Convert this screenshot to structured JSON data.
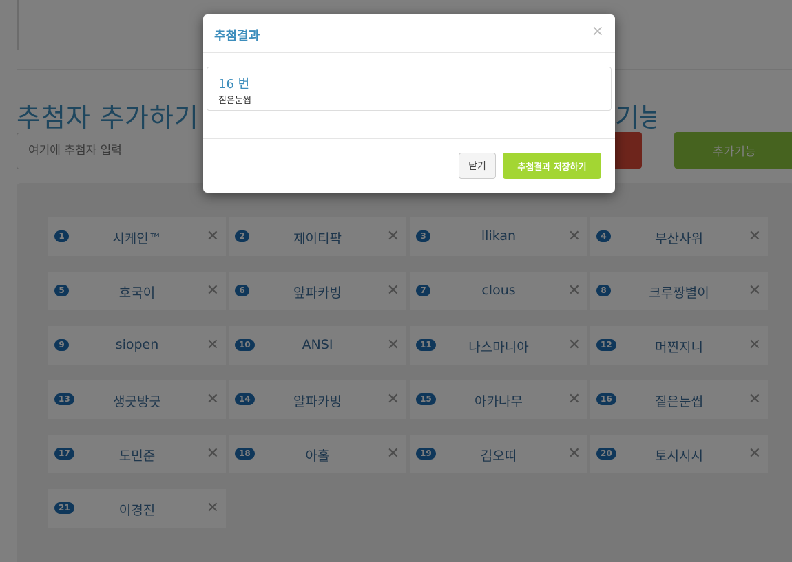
{
  "page": {
    "section_title": "추첨자 추가하기",
    "section_title_right_fragment": "기능",
    "name_input_placeholder": "여기에 추첨자 입력",
    "extra_button_label": "추가기능"
  },
  "participants": [
    {
      "num": "1",
      "name": "시케인™"
    },
    {
      "num": "2",
      "name": "제이티팍"
    },
    {
      "num": "3",
      "name": "llikan"
    },
    {
      "num": "4",
      "name": "부산사위"
    },
    {
      "num": "5",
      "name": "호국이"
    },
    {
      "num": "6",
      "name": "앞파카빙"
    },
    {
      "num": "7",
      "name": "clous"
    },
    {
      "num": "8",
      "name": "크루짱별이"
    },
    {
      "num": "9",
      "name": "siopen"
    },
    {
      "num": "10",
      "name": "ANSI"
    },
    {
      "num": "11",
      "name": "나스마니아"
    },
    {
      "num": "12",
      "name": "머찐지니"
    },
    {
      "num": "13",
      "name": "생긋방긋"
    },
    {
      "num": "14",
      "name": "알파카빙"
    },
    {
      "num": "15",
      "name": "아카나무"
    },
    {
      "num": "16",
      "name": "짙은눈썹"
    },
    {
      "num": "17",
      "name": "도민준"
    },
    {
      "num": "18",
      "name": "아홀"
    },
    {
      "num": "19",
      "name": "김오띠"
    },
    {
      "num": "20",
      "name": "토시시시"
    },
    {
      "num": "21",
      "name": "이경진"
    }
  ],
  "remove_glyph": "✕",
  "modal": {
    "title": "추첨결과",
    "close_glyph": "×",
    "result_number": "16 번",
    "result_name": "짙은눈썹",
    "close_button_label": "닫기",
    "save_button_label": "추첨결과 저장하기"
  },
  "colors": {
    "accent_blue": "#3c8dbc",
    "badge_blue": "#1e6eb4",
    "save_green": "#a3d633",
    "extra_green": "#8cc63f",
    "danger_red": "#dd4b39"
  }
}
